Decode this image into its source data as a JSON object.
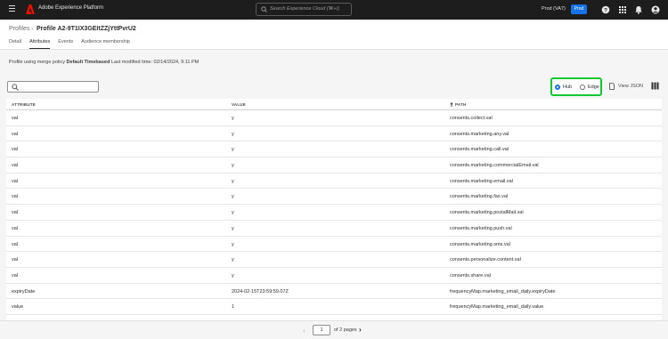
{
  "topbar": {
    "app_title": "Adobe Experience Platform",
    "search_placeholder": "Search Experience Cloud (⌘+/)",
    "sandbox": "Prod (VA7)",
    "badge": "Prod"
  },
  "header": {
    "breadcrumb": "Profiles",
    "title": "Profile A2-9T1IX3GEItZZjYttPvrU2",
    "tabs": [
      {
        "label": "Detail"
      },
      {
        "label": "Attributes"
      },
      {
        "label": "Events"
      },
      {
        "label": "Audience membership"
      }
    ]
  },
  "meta": {
    "prefix": "Profile using merge policy",
    "policy": "Default Timebased",
    "modified": "Last modified time: 02/14/2024, 9:11 PM"
  },
  "controls": {
    "radio_hub": "Hub",
    "radio_edge": "Edge",
    "selected": "Hub",
    "view_json": "View JSON"
  },
  "table": {
    "headers": {
      "attribute": "ATTRIBUTE",
      "value": "VALUE",
      "path": "PATH"
    },
    "rows": [
      {
        "attribute": "val",
        "value": "y",
        "path": "consents.collect.val"
      },
      {
        "attribute": "val",
        "value": "y",
        "path": "consents.marketing.any.val"
      },
      {
        "attribute": "val",
        "value": "y",
        "path": "consents.marketing.call.val"
      },
      {
        "attribute": "val",
        "value": "y",
        "path": "consents.marketing.commercialEmail.val"
      },
      {
        "attribute": "val",
        "value": "y",
        "path": "consents.marketing.email.val"
      },
      {
        "attribute": "val",
        "value": "y",
        "path": "consents.marketing.fax.val"
      },
      {
        "attribute": "val",
        "value": "y",
        "path": "consents.marketing.postalMail.val"
      },
      {
        "attribute": "val",
        "value": "y",
        "path": "consents.marketing.push.val"
      },
      {
        "attribute": "val",
        "value": "y",
        "path": "consents.marketing.sms.val"
      },
      {
        "attribute": "val",
        "value": "y",
        "path": "consents.personalize.content.val"
      },
      {
        "attribute": "val",
        "value": "y",
        "path": "consents.share.val"
      },
      {
        "attribute": "expiryDate",
        "value": "2024-02-15T23:59:59.07Z",
        "path": "frequencyMap.marketing_email_daily.expiryDate"
      },
      {
        "attribute": "value",
        "value": "1",
        "path": "frequencyMap.marketing_email_daily.value"
      }
    ]
  },
  "pager": {
    "current": "1",
    "of_label": "of 2 pages"
  },
  "colors": {
    "accent": "#1473e6",
    "highlight": "#12c832"
  }
}
